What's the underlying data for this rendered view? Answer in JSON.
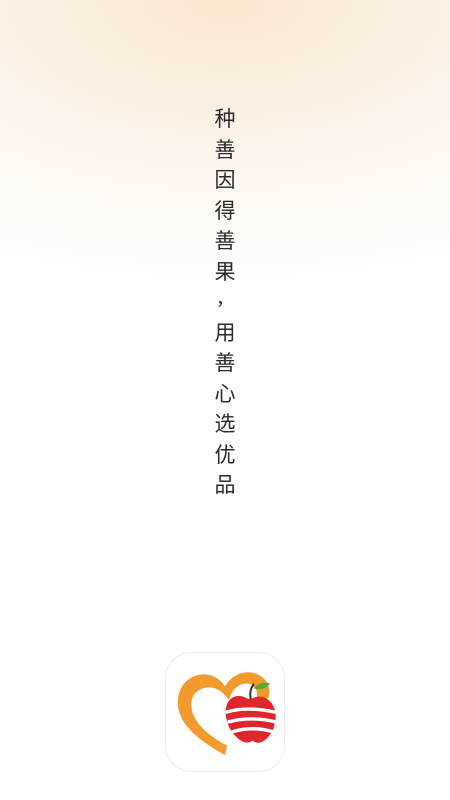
{
  "splash": {
    "slogan_chars": [
      "种",
      "善",
      "因",
      "得",
      "善",
      "果",
      "，",
      "用",
      "善",
      "心",
      "选",
      "优",
      "品"
    ],
    "logo_icon": "heart-apple-logo-icon",
    "colors": {
      "heart_orange": "#f39a2e",
      "apple_red": "#e0262d",
      "leaf_green": "#5aa62e",
      "text": "#2b2b2b"
    }
  }
}
